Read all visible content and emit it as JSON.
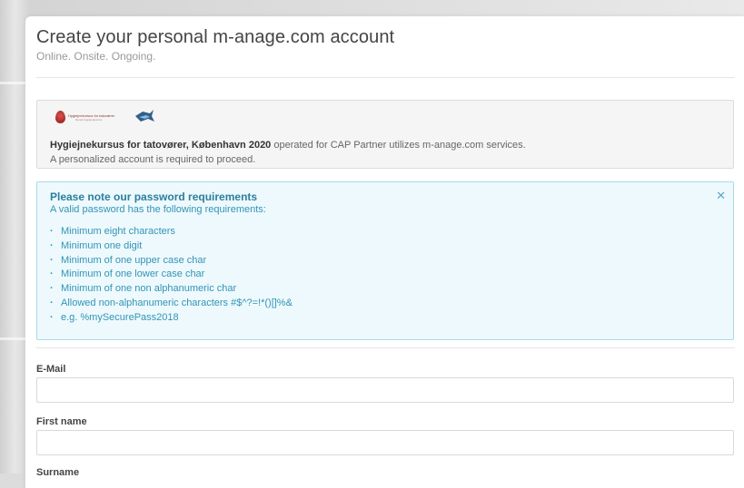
{
  "header": {
    "title": "Create your personal m-anage.com account",
    "tagline": "Online. Onsite. Ongoing."
  },
  "info_box": {
    "logo_text": "Hygiejnekursus for tatoværer",
    "logo_subtext": "Dansk hygiejnekursus",
    "course_name": "Hygiejnekursus for tatovører, København 2020",
    "operated_text": " operated for CAP Partner utilizes m-anage.com services.",
    "account_note": "A personalized account is required to proceed."
  },
  "password_alert": {
    "title": "Please note our password requirements",
    "subtitle": "A valid password has the following requirements:",
    "close_icon": "close-icon",
    "requirements": [
      "Minimum eight characters",
      "Minimum one digit",
      "Minimum of one upper case char",
      "Minimum of one lower case char",
      "Minimum of one non alphanumeric char",
      "Allowed non-alphanumeric characters #$^?=!*()[]%&",
      "e.g. %mySecurePass2018"
    ]
  },
  "form": {
    "email_label": "E-Mail",
    "email_value": "",
    "first_name_label": "First name",
    "first_name_value": "",
    "surname_label": "Surname"
  },
  "colors": {
    "alert_background": "#eef9fd",
    "alert_border": "#a9dbe8",
    "alert_text": "#3194b6",
    "info_background": "#f5f5f5"
  }
}
